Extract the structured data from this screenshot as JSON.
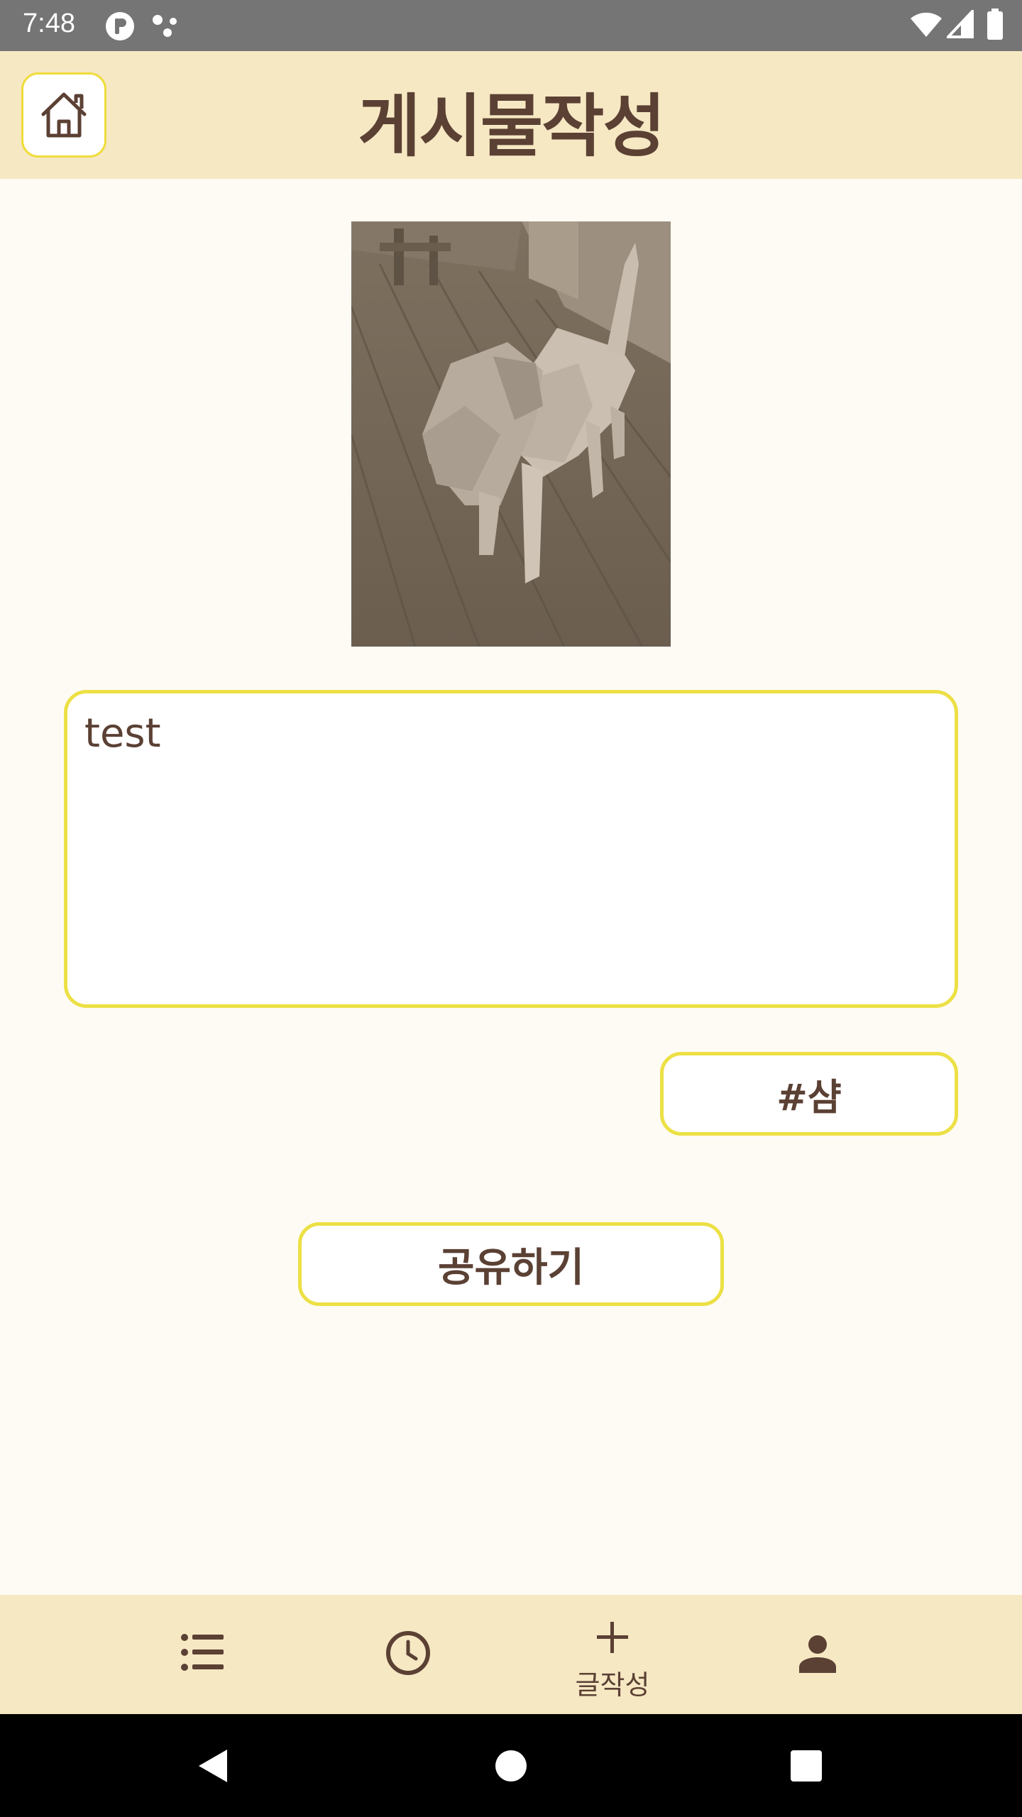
{
  "status_bar": {
    "time": "7:48",
    "icons": [
      "app-notification-icon",
      "dots-icon",
      "wifi-icon",
      "signal-icon",
      "battery-icon"
    ]
  },
  "header": {
    "title": "게시물작성",
    "home_icon": "home-icon"
  },
  "post": {
    "photo_description_icon": "photo",
    "content_value": "test",
    "tag_label": "#샴",
    "share_label": "공유하기"
  },
  "bottom_nav": {
    "items": [
      {
        "icon": "list-icon",
        "label": ""
      },
      {
        "icon": "clock-icon",
        "label": ""
      },
      {
        "icon": "plus-icon",
        "label": "글작성"
      },
      {
        "icon": "person-icon",
        "label": ""
      }
    ]
  },
  "system_nav": {
    "icons": [
      "back-icon",
      "home-circle-icon",
      "recents-icon"
    ]
  },
  "colors": {
    "header_bg": "#f6e8c3",
    "page_bg": "#fefbf5",
    "accent_border": "#ece045",
    "text_brown": "#5b4034",
    "status_bar": "#757575"
  }
}
